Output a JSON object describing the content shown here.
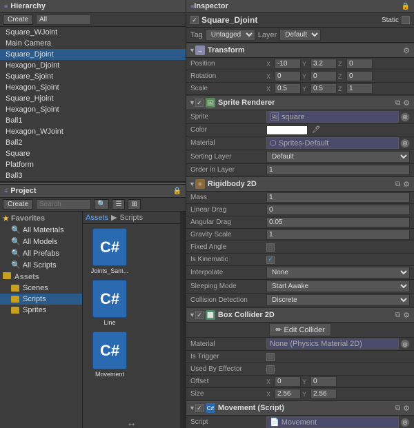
{
  "hierarchy": {
    "title": "Hierarchy",
    "create_label": "Create",
    "search_placeholder": "All",
    "items": [
      {
        "label": "Square_WJoint",
        "selected": false
      },
      {
        "label": "Main Camera",
        "selected": false
      },
      {
        "label": "Square_Djoint",
        "selected": true
      },
      {
        "label": "Hexagon_Djoint",
        "selected": false
      },
      {
        "label": "Square_Sjoint",
        "selected": false
      },
      {
        "label": "Hexagon_Sjoint",
        "selected": false
      },
      {
        "label": "Square_Hjoint",
        "selected": false
      },
      {
        "label": "Hexagon_Sjoint",
        "selected": false
      },
      {
        "label": "Ball1",
        "selected": false
      },
      {
        "label": "Hexagon_WJoint",
        "selected": false
      },
      {
        "label": "Ball2",
        "selected": false
      },
      {
        "label": "Square",
        "selected": false
      },
      {
        "label": "Platform",
        "selected": false
      },
      {
        "label": "Ball3",
        "selected": false
      }
    ]
  },
  "project": {
    "title": "Project",
    "create_label": "Create",
    "breadcrumb": [
      "Assets",
      "Scripts"
    ],
    "favorites": {
      "label": "Favorites",
      "items": [
        "All Materials",
        "All Models",
        "All Prefabs",
        "All Scripts"
      ]
    },
    "assets": {
      "label": "Assets",
      "children": [
        "Scenes",
        "Scripts",
        "Sprites"
      ]
    },
    "files": [
      {
        "name": "Joints_Sam...",
        "type": "cs"
      },
      {
        "name": "Line",
        "type": "cs"
      },
      {
        "name": "Movement",
        "type": "cs"
      }
    ]
  },
  "inspector": {
    "title": "Inspector",
    "object_name": "Square_Djoint",
    "static_label": "Static",
    "tag_label": "Tag",
    "tag_value": "Untagged",
    "layer_label": "Layer",
    "layer_value": "Default",
    "transform": {
      "title": "Transform",
      "position_label": "Position",
      "position": {
        "x": "-10",
        "y": "3.2",
        "z": "0"
      },
      "rotation_label": "Rotation",
      "rotation": {
        "x": "0",
        "y": "0",
        "z": "0"
      },
      "scale_label": "Scale",
      "scale": {
        "x": "0.5",
        "y": "0.5",
        "z": "1"
      }
    },
    "sprite_renderer": {
      "title": "Sprite Renderer",
      "sprite_label": "Sprite",
      "sprite_value": "square",
      "color_label": "Color",
      "material_label": "Material",
      "material_value": "Sprites-Default",
      "sorting_layer_label": "Sorting Layer",
      "sorting_layer_value": "Default",
      "order_label": "Order in Layer",
      "order_value": "1"
    },
    "rigidbody2d": {
      "title": "Rigidbody 2D",
      "mass_label": "Mass",
      "mass_value": "1",
      "linear_drag_label": "Linear Drag",
      "linear_drag_value": "0",
      "angular_drag_label": "Angular Drag",
      "angular_drag_value": "0.05",
      "gravity_scale_label": "Gravity Scale",
      "gravity_scale_value": "1",
      "fixed_angle_label": "Fixed Angle",
      "is_kinematic_label": "Is Kinematic",
      "interpolate_label": "Interpolate",
      "interpolate_value": "None",
      "sleeping_mode_label": "Sleeping Mode",
      "sleeping_mode_value": "Start Awake",
      "collision_label": "Collision Detection",
      "collision_value": "Discrete"
    },
    "box_collider2d": {
      "title": "Box Collider 2D",
      "edit_collider_label": "Edit Collider",
      "material_label": "Material",
      "material_value": "None (Physics Material 2D)",
      "is_trigger_label": "Is Trigger",
      "used_by_effector_label": "Used By Effector",
      "offset_label": "Offset",
      "offset": {
        "x": "0",
        "y": "0"
      },
      "size_label": "Size",
      "size": {
        "x": "2.56",
        "y": "2.56"
      }
    },
    "movement_script": {
      "title": "Movement (Script)",
      "script_label": "Script",
      "script_value": "Movement"
    }
  }
}
